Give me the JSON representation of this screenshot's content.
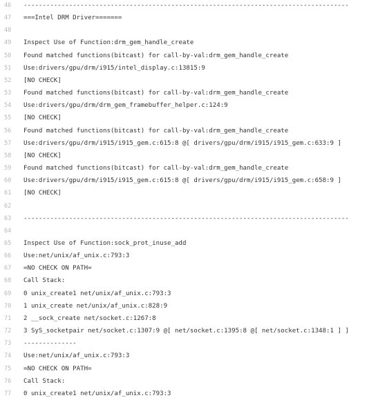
{
  "lines": [
    {
      "n": "46",
      "t": "--------------------------------------------------------------------------------------"
    },
    {
      "n": "47",
      "t": "===Intel DRM Driver======="
    },
    {
      "n": "48",
      "t": ""
    },
    {
      "n": "49",
      "t": "Inspect Use of Function:drm_gem_handle_create"
    },
    {
      "n": "50",
      "t": "Found matched functions(bitcast) for call-by-val:drm_gem_handle_create"
    },
    {
      "n": "51",
      "t": "Use:drivers/gpu/drm/i915/intel_display.c:13815:9"
    },
    {
      "n": "52",
      "t": "[NO CHECK]"
    },
    {
      "n": "53",
      "t": "Found matched functions(bitcast) for call-by-val:drm_gem_handle_create"
    },
    {
      "n": "54",
      "t": "Use:drivers/gpu/drm/drm_gem_framebuffer_helper.c:124:9"
    },
    {
      "n": "55",
      "t": "[NO CHECK]"
    },
    {
      "n": "56",
      "t": "Found matched functions(bitcast) for call-by-val:drm_gem_handle_create"
    },
    {
      "n": "57",
      "t": "Use:drivers/gpu/drm/i915/i915_gem.c:615:8 @[ drivers/gpu/drm/i915/i915_gem.c:633:9 ]"
    },
    {
      "n": "58",
      "t": "[NO CHECK]"
    },
    {
      "n": "59",
      "t": "Found matched functions(bitcast) for call-by-val:drm_gem_handle_create"
    },
    {
      "n": "60",
      "t": "Use:drivers/gpu/drm/i915/i915_gem.c:615:8 @[ drivers/gpu/drm/i915/i915_gem.c:658:9 ]"
    },
    {
      "n": "61",
      "t": "[NO CHECK]"
    },
    {
      "n": "62",
      "t": ""
    },
    {
      "n": "63",
      "t": "--------------------------------------------------------------------------------------"
    },
    {
      "n": "64",
      "t": ""
    },
    {
      "n": "65",
      "t": "Inspect Use of Function:sock_prot_inuse_add"
    },
    {
      "n": "66",
      "t": "Use:net/unix/af_unix.c:793:3"
    },
    {
      "n": "67",
      "t": "=NO CHECK ON PATH="
    },
    {
      "n": "68",
      "t": "Call Stack:"
    },
    {
      "n": "69",
      "t": "0 unix_create1 net/unix/af_unix.c:793:3"
    },
    {
      "n": "70",
      "t": "1 unix_create net/unix/af_unix.c:828:9"
    },
    {
      "n": "71",
      "t": "2 __sock_create net/socket.c:1267:8"
    },
    {
      "n": "72",
      "t": "3 SyS_socketpair net/socket.c:1307:9 @[ net/socket.c:1395:8 @[ net/socket.c:1348:1 ] ]"
    },
    {
      "n": "73",
      "t": "--------------"
    },
    {
      "n": "74",
      "t": "Use:net/unix/af_unix.c:793:3"
    },
    {
      "n": "75",
      "t": "=NO CHECK ON PATH="
    },
    {
      "n": "76",
      "t": "Call Stack:"
    },
    {
      "n": "77",
      "t": "0 unix_create1 net/unix/af_unix.c:793:3"
    }
  ]
}
